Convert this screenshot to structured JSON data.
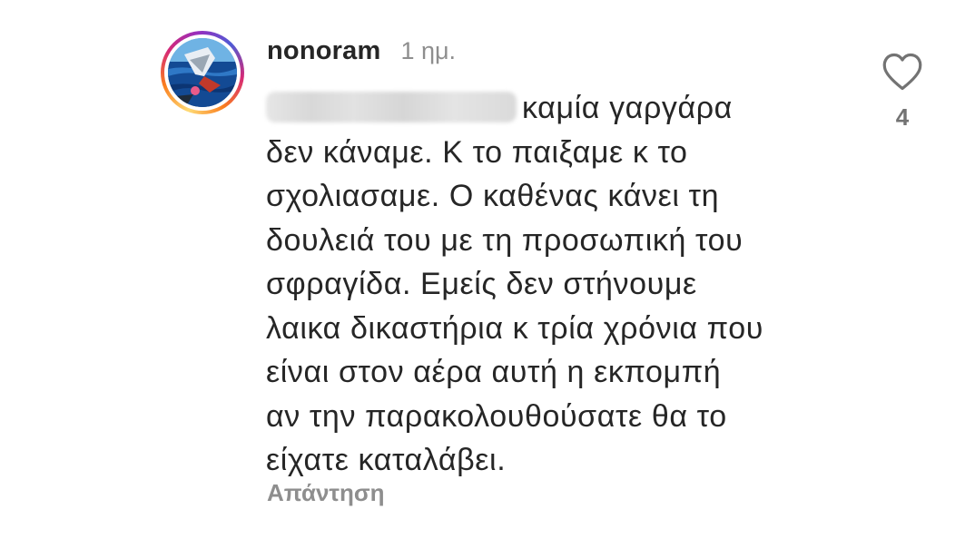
{
  "comment": {
    "username": "nonoram",
    "timestamp": "1 ημ.",
    "lines": [
      "καμία γαργάρα",
      "δεν κάναμε. Κ το παιξαμε κ το",
      "σχολιασαμε. Ο καθένας κάνει τη",
      "δουλειά του με τη προσωπική του",
      "σφραγίδα. Εμείς δεν στήνουμε",
      "λαικα δικαστήρια κ τρία χρόνια που",
      "είναι στον αέρα αυτή η εκπομπή",
      "αν την παρακολουθούσατε θα το",
      "είχατε καταλάβει."
    ],
    "reply_label": "Απάντηση",
    "like_count": "4"
  },
  "icons": {
    "heart": "heart-outline-icon",
    "mention": "blurred-mention"
  },
  "colors": {
    "text": "#262626",
    "secondary": "#8e8e8e",
    "like_count": "#737373"
  }
}
